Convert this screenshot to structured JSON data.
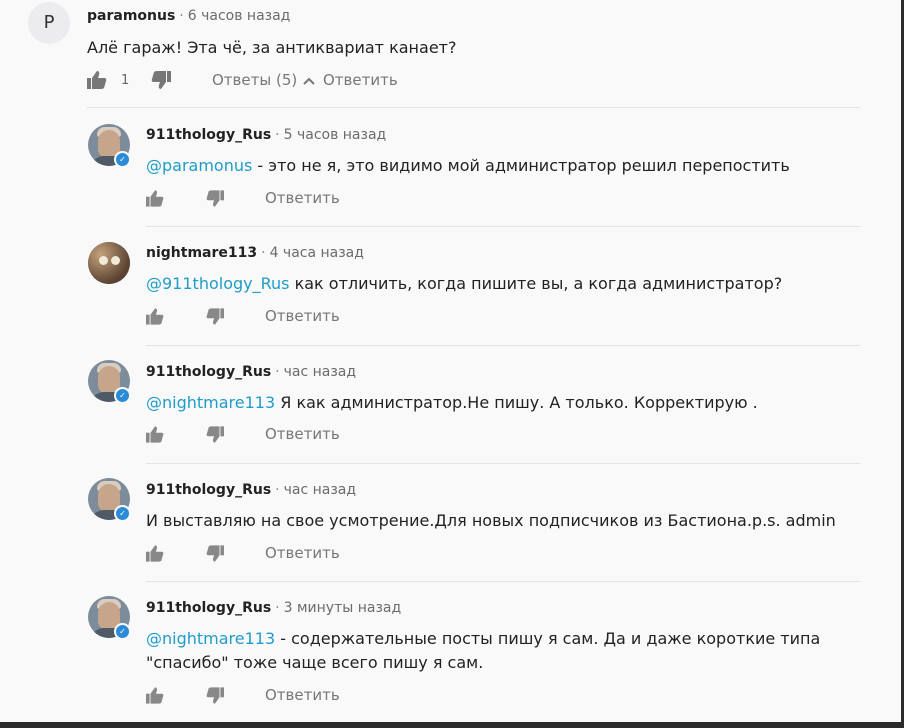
{
  "comments": [
    {
      "author": "paramonus",
      "time": "6 часов назад",
      "avatar_letter": "P",
      "mention": "",
      "text": "Алё гараж! Эта чё, за антиквариат канает?",
      "likes": "1",
      "replies_label": "Ответы (5)",
      "reply_label": "Ответить"
    },
    {
      "author": "911thology_Rus",
      "time": "5 часов назад",
      "mention": "@paramonus",
      "text": " - это не я, это видимо мой администратор решил перепостить",
      "reply_label": "Ответить"
    },
    {
      "author": "nightmare113",
      "time": "4 часа назад",
      "mention": "@911thology_Rus",
      "text": " как отличить, когда пишите вы, а когда администратор?",
      "reply_label": "Ответить"
    },
    {
      "author": "911thology_Rus",
      "time": "час назад",
      "mention": "@nightmare113",
      "text": " Я как администратор.Не пишу. А только. Корректирую .",
      "reply_label": "Ответить"
    },
    {
      "author": "911thology_Rus",
      "time": "час назад",
      "mention": "",
      "text": "И выставляю на свое усмотрение.Для новых подписчиков из Бастиона.p.s. admin",
      "reply_label": "Ответить"
    },
    {
      "author": "911thology_Rus",
      "time": "3 минуты назад",
      "mention": "@nightmare113",
      "text": " - содержательные посты пишу я сам. Да и даже короткие типа \"спасибо\" тоже чаще всего пишу я сам.",
      "reply_label": "Ответить"
    }
  ],
  "separator_dot": "·",
  "colors": {
    "mention": "#1f9cc8",
    "verified": "#2b8bd6",
    "background": "#f9f9fa"
  }
}
